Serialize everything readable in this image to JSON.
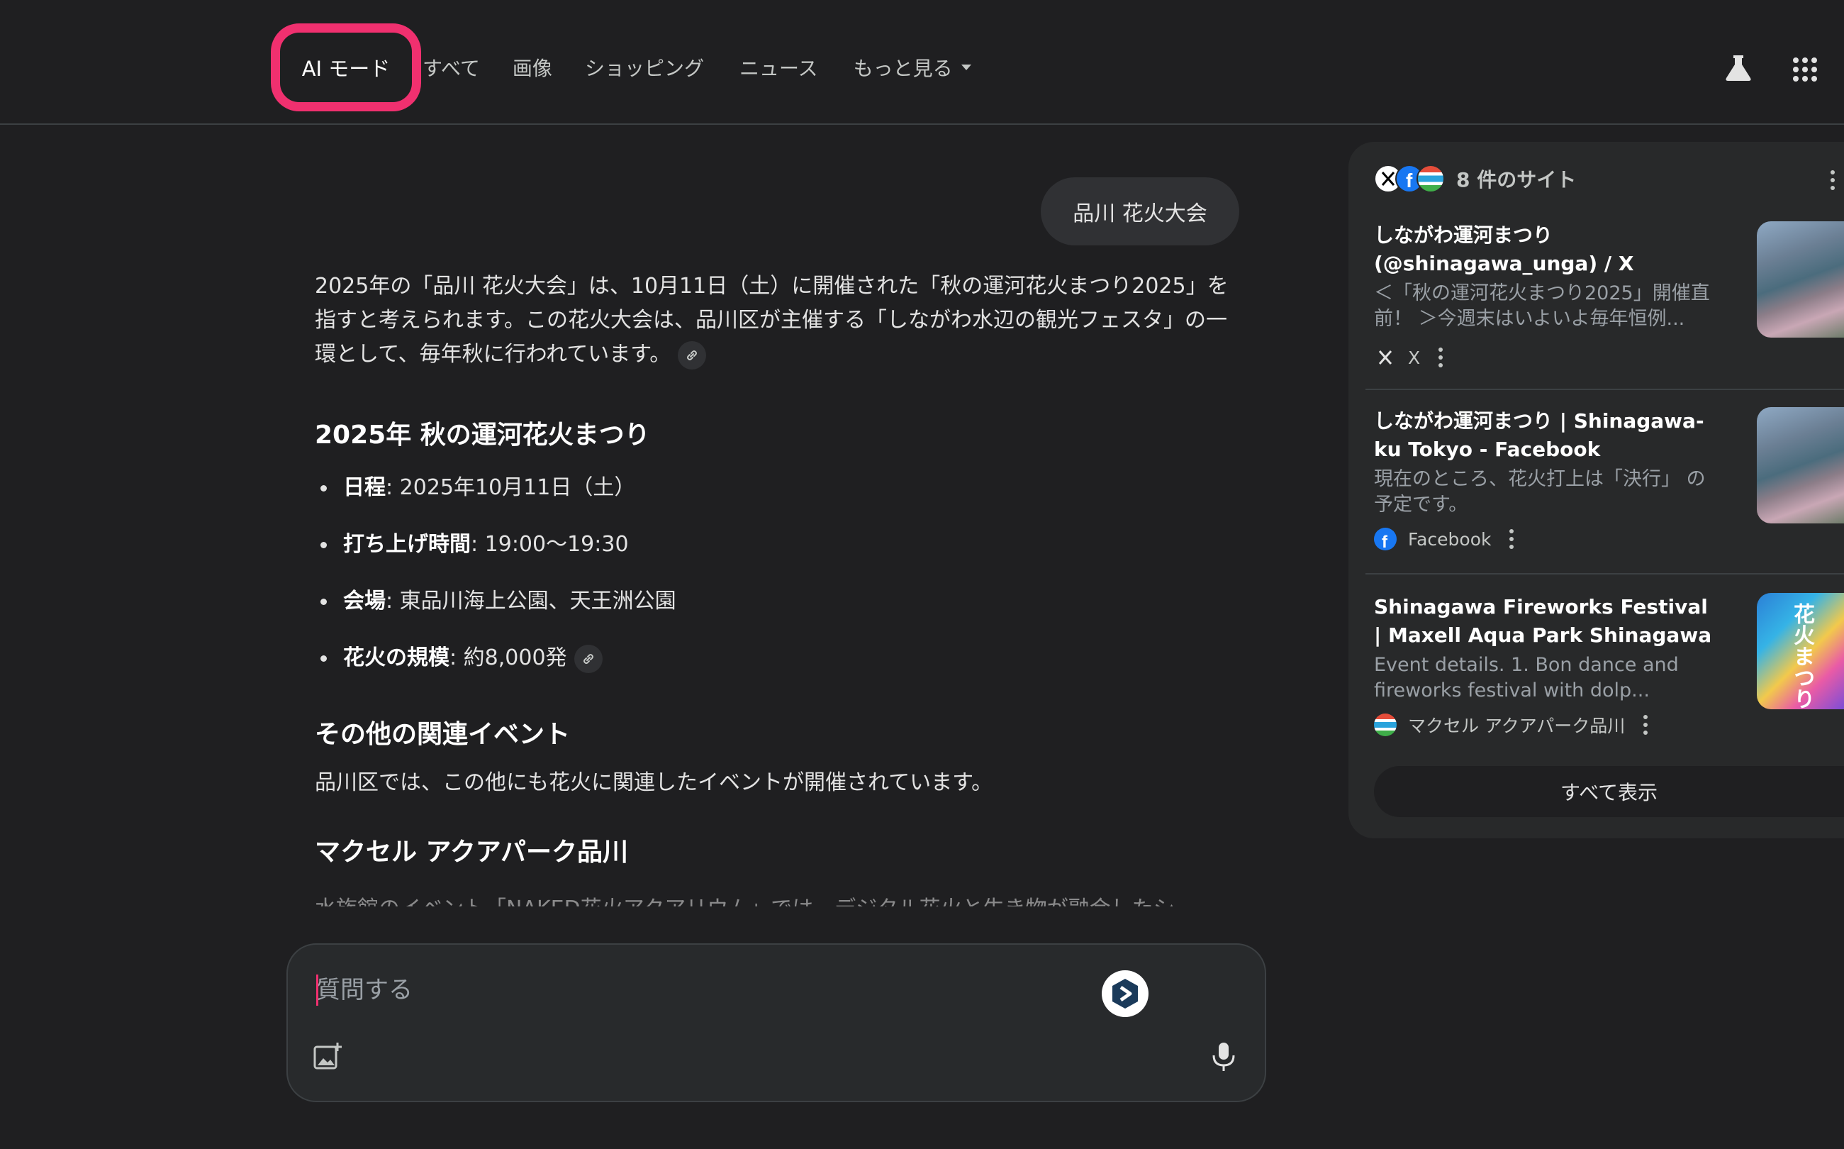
{
  "nav": {
    "tabs": [
      "AI モード",
      "すべて",
      "画像",
      "ショッピング",
      "ニュース",
      "もっと見る"
    ],
    "highlight_color": "#f0306f",
    "icons": [
      "labs-flask-icon",
      "google-apps-icon"
    ]
  },
  "query": "品川 花火大会",
  "answer": {
    "intro": "2025年の「品川 花火大会」は、10月11日（土）に開催された「秋の運河花火まつり2025」を指すと考えられます。この花火大会は、品川区が主催する「しながわ水辺の観光フェスタ」の一環として、毎年秋に行われています。",
    "section1_title": "2025年 秋の運河花火まつり",
    "details": [
      {
        "label": "日程",
        "value": ": 2025年10月11日（土）"
      },
      {
        "label": "打ち上げ時間",
        "value": ": 19:00～19:30"
      },
      {
        "label": "会場",
        "value": ": 東品川海上公園、天王洲公園"
      },
      {
        "label": "花火の規模",
        "value": ": 約8,000発"
      }
    ],
    "section2_title": "その他の関連イベント",
    "section2_text": "品川区では、この他にも花火に関連したイベントが開催されています。",
    "section3_title": "マクセル アクアパーク品川",
    "section3_text_cut": "水族館のイベント「NAKED花火アクアリウム」では、デジタル花火と生き物が融合したシ"
  },
  "input": {
    "placeholder": "質問する"
  },
  "sources": {
    "count_label": "8 件のサイト",
    "items": [
      {
        "title": "しながわ運河まつり (@shinagawa_unga) / X",
        "snippet": "＜「秋の運河花火まつり2025」開催直前！ ＞今週末はいよいよ毎年恒例...",
        "site": "X"
      },
      {
        "title": "しながわ運河まつり | Shinagawa-ku Tokyo - Facebook",
        "snippet": "現在のところ、花火打上は「決行」 の予定です。",
        "site": "Facebook"
      },
      {
        "title": "Shinagawa Fireworks Festival | Maxell Aqua Park Shinagawa",
        "snippet": "Event details. 1. Bon dance and fireworks festival with dolp...",
        "site": "マクセル アクアパーク品川",
        "thumb_text": "花火まつり"
      }
    ],
    "show_all": "すべて表示"
  }
}
